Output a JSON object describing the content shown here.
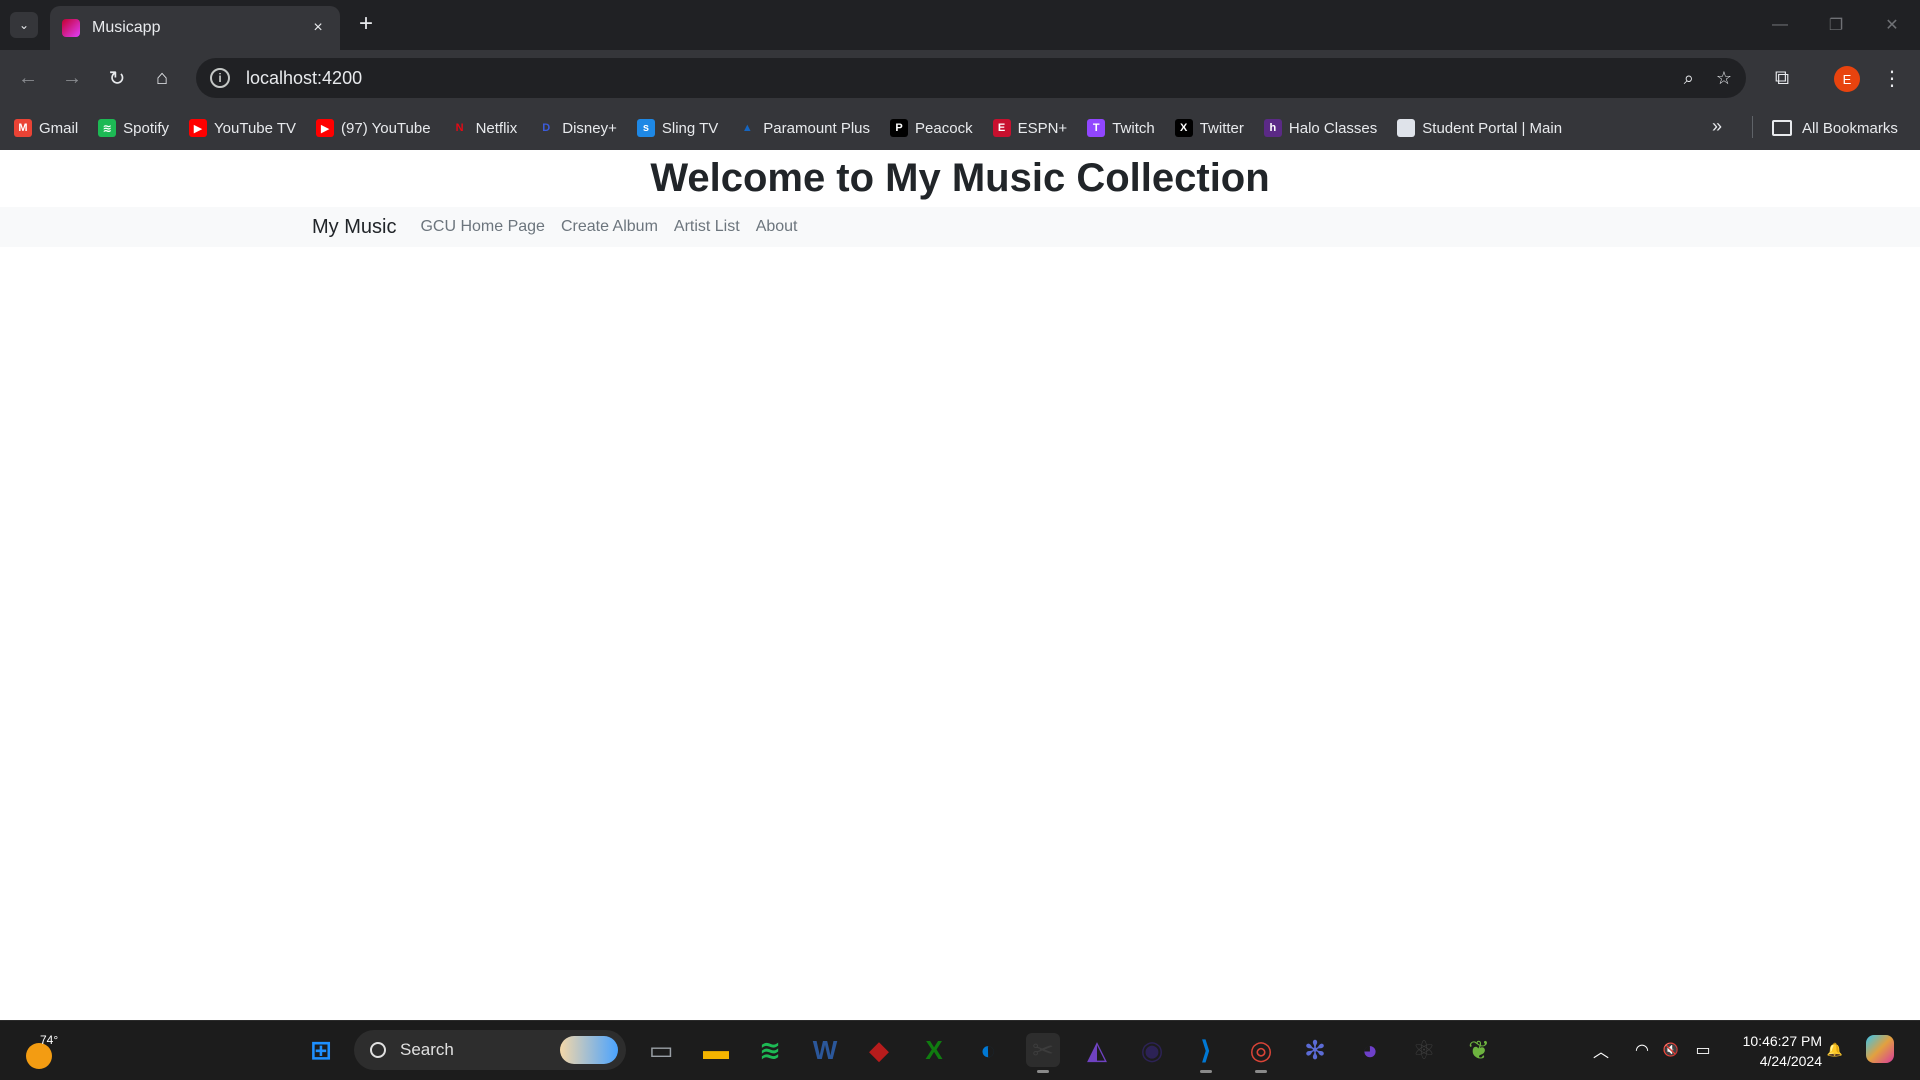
{
  "browser": {
    "tab_title": "Musicapp",
    "tab_close_icon": "×",
    "new_tab_icon": "+",
    "tab_search_icon": "⌄",
    "url": "localhost:4200",
    "nav_icons": {
      "back": "←",
      "forward": "→",
      "reload": "↻",
      "home": "⌂"
    },
    "omnibox_icons": {
      "zoom": "⌕",
      "star": "☆"
    },
    "extensions_icon": "⧉",
    "menu_icon": "⋮",
    "profile_initial": "E",
    "window_controls": {
      "minimize": "—",
      "restore": "❐",
      "close": "✕"
    },
    "bookmarks": [
      {
        "label": "Gmail",
        "icon": "gmail-icon",
        "color": "#ea4335",
        "glyph": "M"
      },
      {
        "label": "Spotify",
        "icon": "spotify-icon",
        "color": "#1db954",
        "glyph": "≋"
      },
      {
        "label": "YouTube TV",
        "icon": "youtube-tv-icon",
        "color": "#ff0000",
        "glyph": "▶"
      },
      {
        "label": "(97) YouTube",
        "icon": "youtube-icon",
        "color": "#ff0000",
        "glyph": "▶"
      },
      {
        "label": "Netflix",
        "icon": "netflix-icon",
        "color": "#35363a",
        "glyph": "N"
      },
      {
        "label": "Disney+",
        "icon": "disney-plus-icon",
        "color": "#35363a",
        "glyph": "D"
      },
      {
        "label": "Sling TV",
        "icon": "sling-tv-icon",
        "color": "#1e88e5",
        "glyph": "s"
      },
      {
        "label": "Paramount Plus",
        "icon": "paramount-plus-icon",
        "color": "#35363a",
        "glyph": "▲"
      },
      {
        "label": "Peacock",
        "icon": "peacock-icon",
        "color": "#000000",
        "glyph": "P"
      },
      {
        "label": "ESPN+",
        "icon": "espn-plus-icon",
        "color": "#c8102e",
        "glyph": "E"
      },
      {
        "label": "Twitch",
        "icon": "twitch-icon",
        "color": "#9146ff",
        "glyph": "T"
      },
      {
        "label": "Twitter",
        "icon": "twitter-x-icon",
        "color": "#000000",
        "glyph": "X"
      },
      {
        "label": "Halo Classes",
        "icon": "halo-icon",
        "color": "#5b2a86",
        "glyph": "h"
      },
      {
        "label": "Student Portal | Main",
        "icon": "student-portal-icon",
        "color": "#dfe3ea",
        "glyph": ""
      }
    ],
    "bookmarks_more_icon": "»",
    "all_bookmarks_label": "All Bookmarks"
  },
  "page": {
    "heading": "Welcome to My Music Collection",
    "navbar": {
      "brand": "My Music",
      "links": [
        "GCU Home Page",
        "Create Album",
        "Artist List",
        "About"
      ]
    }
  },
  "taskbar": {
    "weather_temp": "74°",
    "search_label": "Search",
    "apps": [
      {
        "name": "start-icon",
        "color": "#1e90ff",
        "glyph": "⊞"
      },
      {
        "name": "task-view-icon",
        "color": "#9aa0a6",
        "glyph": "▭"
      },
      {
        "name": "file-explorer-icon",
        "color": "#f4b400",
        "glyph": "▬"
      },
      {
        "name": "spotify-icon",
        "color": "#1db954",
        "glyph": "≋"
      },
      {
        "name": "word-icon",
        "color": "#2b579a",
        "glyph": "W"
      },
      {
        "name": "game-app-icon",
        "color": "#b71c1c",
        "glyph": "◆"
      },
      {
        "name": "xbox-icon",
        "color": "#107c10",
        "glyph": "X"
      },
      {
        "name": "shield-app-icon",
        "color": "#0078d4",
        "glyph": "◐"
      },
      {
        "name": "snipping-tool-icon",
        "color": "#3c3c3c",
        "glyph": "✂"
      },
      {
        "name": "visual-studio-icon",
        "color": "#6f42c1",
        "glyph": "◭"
      },
      {
        "name": "eclipse-icon",
        "color": "#2c2255",
        "glyph": "◉"
      },
      {
        "name": "vscode-icon",
        "color": "#0078d4",
        "glyph": "⟩"
      },
      {
        "name": "chrome-icon",
        "color": "#db4437",
        "glyph": "◎"
      },
      {
        "name": "settings-app-icon",
        "color": "#5b6bd5",
        "glyph": "✻"
      },
      {
        "name": "github-icon",
        "color": "#6e40c9",
        "glyph": "◕"
      },
      {
        "name": "react-app-icon",
        "color": "#3c3c3c",
        "glyph": "⚛"
      },
      {
        "name": "spring-icon",
        "color": "#6db33f",
        "glyph": "❦"
      }
    ],
    "tray_icons": {
      "chevron": "︿",
      "wifi": "◠",
      "volume": "🔇",
      "battery": "▭",
      "bell": "🔔"
    },
    "time": "10:46:27 PM",
    "date": "4/24/2024"
  }
}
